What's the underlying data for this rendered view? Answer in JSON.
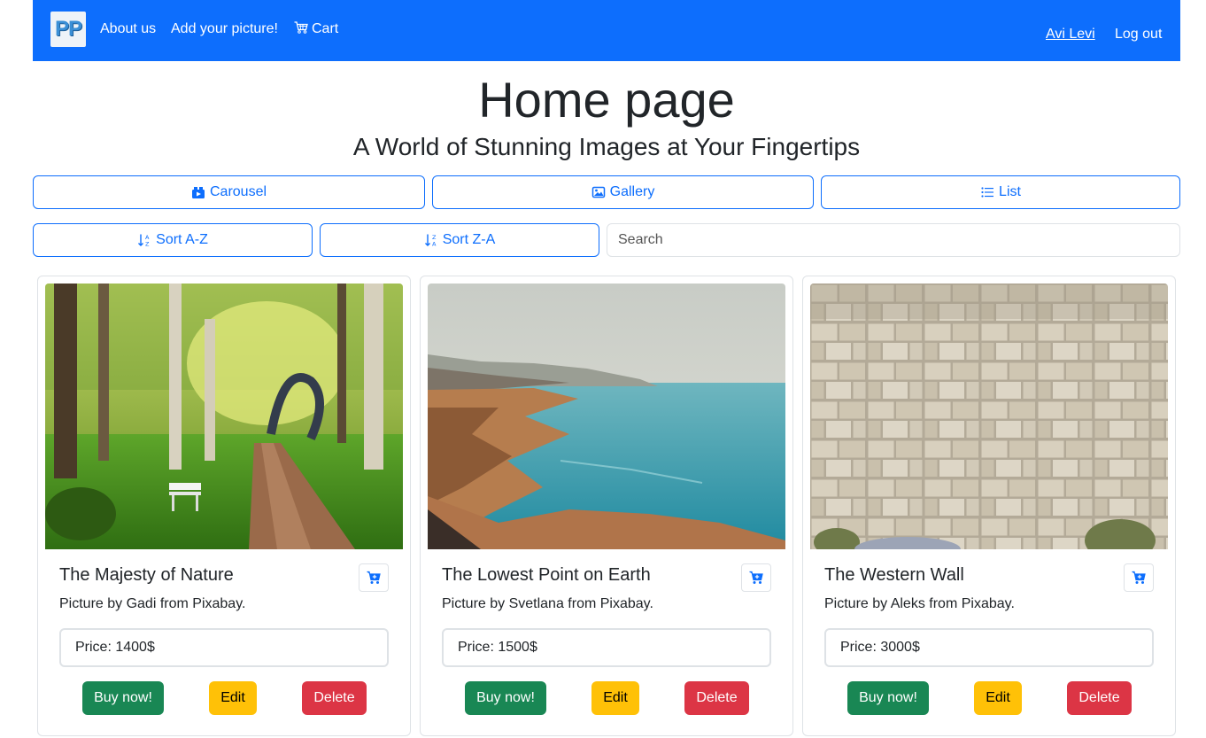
{
  "navbar": {
    "logo_text": "PP",
    "about": "About us",
    "add_picture": "Add your picture!",
    "cart": "Cart",
    "user": "Avi Levi",
    "logout": "Log out"
  },
  "header": {
    "title": "Home page",
    "subtitle": "A World of Stunning Images at Your Fingertips"
  },
  "views": {
    "carousel": "Carousel",
    "gallery": "Gallery",
    "list": "List"
  },
  "sort": {
    "az": "Sort A-Z",
    "za": "Sort Z-A"
  },
  "search": {
    "placeholder": "Search"
  },
  "cards": [
    {
      "title": "The Majesty of Nature",
      "credit": "Picture by Gadi from Pixabay.",
      "price": "Price: 1400$",
      "buy": "Buy now!",
      "edit": "Edit",
      "delete": "Delete",
      "image": "forest-path-with-bench"
    },
    {
      "title": "The Lowest Point on Earth",
      "credit": "Picture by Svetlana from Pixabay.",
      "price": "Price: 1500$",
      "buy": "Buy now!",
      "edit": "Edit",
      "delete": "Delete",
      "image": "dead-sea-coastline"
    },
    {
      "title": "The Western Wall",
      "credit": "Picture by Aleks from Pixabay.",
      "price": "Price: 3000$",
      "buy": "Buy now!",
      "edit": "Edit",
      "delete": "Delete",
      "image": "stone-wall"
    }
  ],
  "colors": {
    "primary": "#0d6efd",
    "success": "#198754",
    "warning": "#ffc107",
    "danger": "#dc3545"
  }
}
